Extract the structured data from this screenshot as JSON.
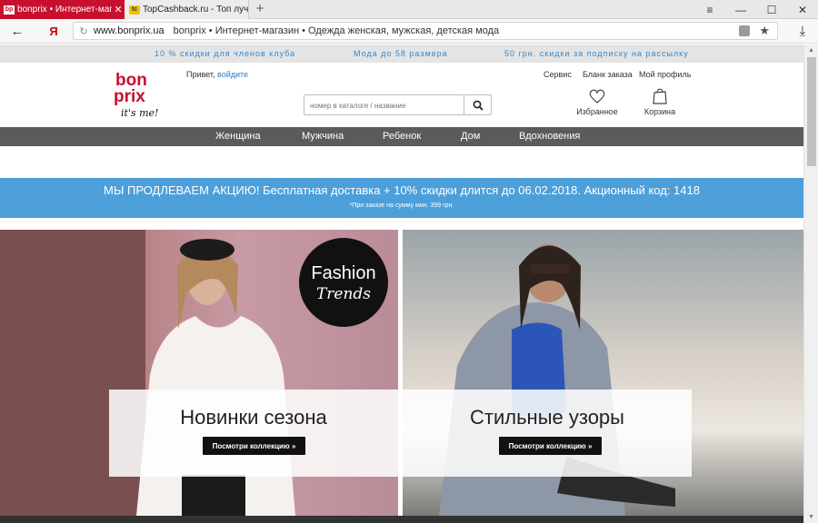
{
  "browser": {
    "tabs": [
      {
        "label": "bonprix • Интернет-мага",
        "favicon": "bp",
        "active": true
      },
      {
        "label": "TopCashback.ru - Топ лучши",
        "favicon": "tc",
        "active": false
      }
    ],
    "new_tab": "+",
    "nav": {
      "back": "←",
      "yandex": "Я"
    },
    "window_controls": {
      "menu": "≡",
      "minimize": "—",
      "maximize": "☐",
      "close": "✕"
    },
    "address": {
      "host": "www.bonprix.ua",
      "title": "bonprix • Интернет-магазин • Одежда женская, мужская, детская мода"
    },
    "download_icon": "⤓"
  },
  "promo_strip": [
    "10 % скидки для членов клуба",
    "Мода до 58 размера",
    "50 грн. скидки за подписку на рассылку"
  ],
  "header": {
    "greeting": "Привет,",
    "login_link": "войдите",
    "links": [
      "Сервис",
      "Бланк заказа",
      "Мой профиль"
    ],
    "search_placeholder": "номер в каталоге / название",
    "favorites_label": "Избранное",
    "cart_label": "Корзина",
    "logo": {
      "line1": "bon",
      "line2": "prix",
      "tagline": "it's me!"
    }
  },
  "categories": [
    "Женщина",
    "Мужчина",
    "Ребенок",
    "Дом",
    "Вдохновения"
  ],
  "banner": {
    "main": "МЫ ПРОДЛЕВАЕМ АКЦИЮ! Бесплатная доставка + 10% скидки длится до 06.02.2018. Акционный код: 1418",
    "sub": "*При заказе на сумму мин. 399 грн."
  },
  "hero": [
    {
      "title": "Новинки сезона",
      "button": "Посмотри коллекцию »",
      "badge_line1": "Fashion",
      "badge_line2": "Trends"
    },
    {
      "title": "Стильные узоры",
      "button": "Посмотри коллекцию »"
    }
  ],
  "colors": {
    "brand_red": "#c8102e",
    "banner_blue": "#4d9fda",
    "nav_gray": "#5b5b5b",
    "promo_text": "#3a87c8"
  }
}
